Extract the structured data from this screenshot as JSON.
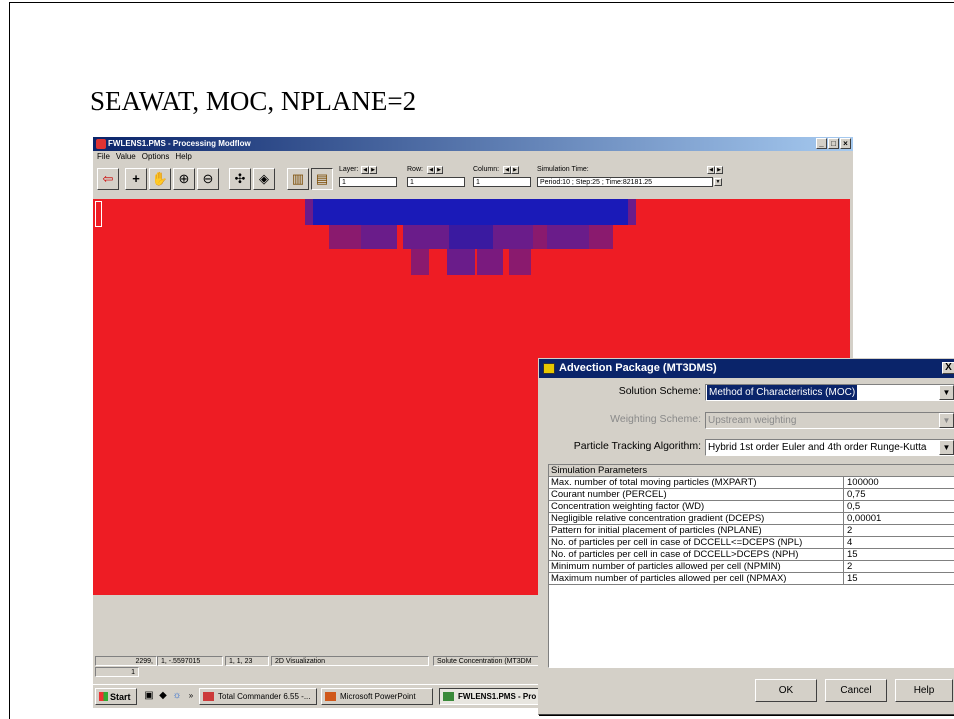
{
  "slide": {
    "title": "SEAWAT, MOC, NPLANE=2"
  },
  "app": {
    "title": "FWLENS1.PMS - Processing Modflow",
    "window_buttons": [
      "_",
      "□",
      "×"
    ],
    "menu": [
      "File",
      "Value",
      "Options",
      "Help"
    ],
    "toolbar": {
      "tools": [
        {
          "name": "exit-icon",
          "glyph": "⇦"
        },
        {
          "name": "crosshair-icon",
          "glyph": "+"
        },
        {
          "name": "hand-icon",
          "glyph": "✋"
        },
        {
          "name": "zoom-in-icon",
          "glyph": "⊕"
        },
        {
          "name": "zoom-out-icon",
          "glyph": "⊖"
        },
        {
          "name": "pan-icon",
          "glyph": "✣"
        },
        {
          "name": "diamond-icon",
          "glyph": "◈"
        },
        {
          "name": "grid-columns-icon",
          "glyph": "▥"
        },
        {
          "name": "grid-rows-icon",
          "glyph": "▤"
        }
      ],
      "layer_label": "Layer:",
      "layer_value": "1",
      "row_label": "Row:",
      "row_value": "1",
      "column_label": "Column:",
      "column_value": "1",
      "simtime_label": "Simulation Time:",
      "simtime_value": "Period:10 ; Step:25 ; Time:82181.25"
    },
    "plot_colors": {
      "background": "#ee1c24",
      "low": "#1a1ab8",
      "mid": "#6a1c8a",
      "edge": "#8a1a6e"
    },
    "status": {
      "coords": "2299,",
      "value": "1, -.5597015",
      "cell": "1, 1, 23",
      "mode": "2D Visualization",
      "data": "Solute Concentration (MT3DM",
      "row2": "1"
    }
  },
  "taskbar": {
    "start": "Start",
    "tasks": [
      {
        "label": "Total Commander 6.55 -...",
        "active": false
      },
      {
        "label": "Microsoft PowerPoint",
        "active": false
      },
      {
        "label": "FWLENS1.PMS - Pro",
        "active": true
      }
    ]
  },
  "dialog": {
    "title": "Advection Package (MT3DMS)",
    "close": "X",
    "solution_label": "Solution Scheme:",
    "solution_value": "Method of Characteristics (MOC)",
    "weighting_label": "Weighting Scheme:",
    "weighting_value": "Upstream weighting",
    "tracking_label": "Particle Tracking Algorithm:",
    "tracking_value": "Hybrid 1st order Euler and 4th order Runge-Kutta",
    "params_header": "Simulation Parameters",
    "params": [
      {
        "name": "Max. number of total moving particles (MXPART)",
        "value": "100000"
      },
      {
        "name": "Courant number (PERCEL)",
        "value": "0,75"
      },
      {
        "name": "Concentration weighting factor (WD)",
        "value": "0,5"
      },
      {
        "name": "Negligible relative concentration gradient (DCEPS)",
        "value": "0,00001"
      },
      {
        "name": "Pattern for initial placement of particles (NPLANE)",
        "value": "2"
      },
      {
        "name": "No. of particles per cell in case of DCCELL<=DCEPS (NPL)",
        "value": "4"
      },
      {
        "name": "No. of particles per cell in case of DCCELL>DCEPS (NPH)",
        "value": "15"
      },
      {
        "name": "Minimum number of particles allowed per cell (NPMIN)",
        "value": "2"
      },
      {
        "name": "Maximum number of particles allowed per cell (NPMAX)",
        "value": "15"
      }
    ],
    "ok": "OK",
    "cancel": "Cancel",
    "help": "Help"
  }
}
